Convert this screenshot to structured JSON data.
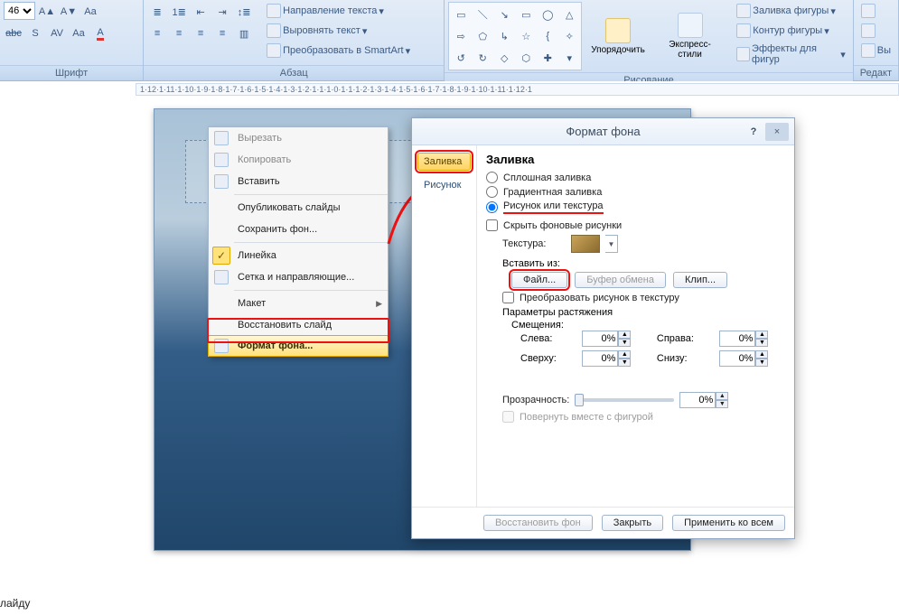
{
  "ribbon": {
    "font_group": "Шрифт",
    "font_size": "46",
    "paragraph_group": "Абзац",
    "drawing_group": "Рисование",
    "edit_group": "Редакт",
    "text_direction": "Направление текста",
    "align_text": "Выровнять текст",
    "convert_smartart": "Преобразовать в SmartArt",
    "arrange": "Упорядочить",
    "quick_styles": "Экспресс-стили",
    "shape_fill": "Заливка фигуры",
    "shape_outline": "Контур фигуры",
    "shape_effects": "Эффекты для фигур",
    "vis": "Вы"
  },
  "ruler": "1·12·1·11·1·10·1·9·1·8·1·7·1·6·1·5·1·4·1·3·1·2·1·1·1·0·1·1·1·2·1·3·1·4·1·5·1·6·1·7·1·8·1·9·1·10·1·11·1·12·1",
  "context_menu": {
    "cut": "Вырезать",
    "copy": "Копировать",
    "paste": "Вставить",
    "publish": "Опубликовать слайды",
    "save_bg": "Сохранить фон...",
    "ruler": "Линейка",
    "grid": "Сетка и направляющие...",
    "layout": "Макет",
    "reset": "Восстановить слайд",
    "format_bg": "Формат фона..."
  },
  "dialog": {
    "title": "Формат фона",
    "nav_fill": "Заливка",
    "nav_picture": "Рисунок",
    "pane_title": "Заливка",
    "radio_solid": "Сплошная заливка",
    "radio_gradient": "Градиентная заливка",
    "radio_picture": "Рисунок или текстура",
    "hide_bg": "Скрыть фоновые рисунки",
    "texture": "Текстура:",
    "insert_from": "Вставить из:",
    "btn_file": "Файл...",
    "btn_clipboard": "Буфер обмена",
    "btn_clip": "Клип...",
    "to_texture": "Преобразовать рисунок в текстуру",
    "stretch_hdr": "Параметры растяжения",
    "offsets": "Смещения:",
    "left": "Слева:",
    "right": "Справа:",
    "top": "Сверху:",
    "bottom": "Снизу:",
    "pct": "0%",
    "transparency": "Прозрачность:",
    "rotate": "Повернуть вместе с фигурой",
    "btn_reset": "Восстановить фон",
    "btn_close": "Закрыть",
    "btn_apply_all": "Применить ко всем"
  },
  "footer": "лайду"
}
